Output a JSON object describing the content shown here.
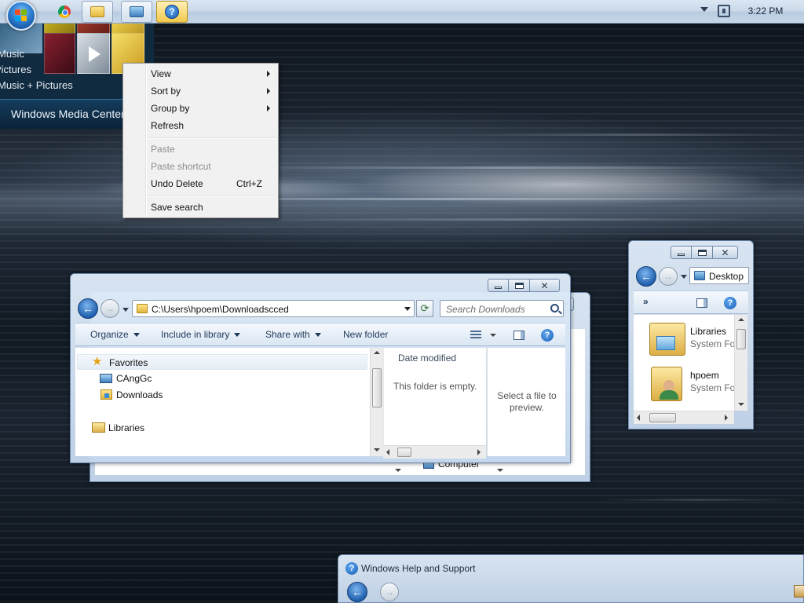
{
  "taskbar": {
    "clock": "3:22 PM",
    "buttons": [
      {
        "name": "google-chrome"
      },
      {
        "name": "windows-explorer"
      },
      {
        "name": "remote-desktop"
      },
      {
        "name": "windows-help-and-support"
      }
    ]
  },
  "media_center": {
    "menu_items": [
      "Music",
      "Pictures",
      "Music + Pictures"
    ],
    "title": "Windows Media Center"
  },
  "context_menu": {
    "items": [
      {
        "label": "View",
        "submenu": true,
        "enabled": true
      },
      {
        "label": "Sort by",
        "submenu": true,
        "enabled": true
      },
      {
        "label": "Group by",
        "submenu": true,
        "enabled": true
      },
      {
        "label": "Refresh",
        "submenu": false,
        "enabled": true
      },
      {
        "label": "Paste",
        "submenu": false,
        "enabled": false
      },
      {
        "label": "Paste shortcut",
        "submenu": false,
        "enabled": false
      },
      {
        "label": "Undo Delete",
        "shortcut": "Ctrl+Z",
        "submenu": false,
        "enabled": true
      },
      {
        "label": "Save search",
        "submenu": false,
        "enabled": true
      }
    ]
  },
  "explorer_main": {
    "address": "C:\\Users\\hpoem\\Downloadscced",
    "search_placeholder": "Search Downloads",
    "commands": {
      "organize": "Organize",
      "include_in_library": "Include in library",
      "share_with": "Share with",
      "new_folder": "New folder"
    },
    "nav_tree": {
      "favorites": "Favorites",
      "items": [
        "CAngGc",
        "Downloads"
      ],
      "libraries": "Libraries"
    },
    "column_header": "Date modified",
    "empty_message": "This folder is empty.",
    "preview_message": "Select a file to preview."
  },
  "explorer_back": {
    "nav_item": "Computer"
  },
  "explorer_desktop": {
    "address": "Desktop",
    "items": [
      {
        "name": "Libraries",
        "type": "System Fo"
      },
      {
        "name": "hpoem",
        "type": "System Fo"
      }
    ]
  },
  "help_window": {
    "title": "Windows Help and Support"
  },
  "colors": {
    "accent": "#1f5fae",
    "taskbar": "#c9d8e9",
    "menu_bg": "#f1f1f1",
    "disabled_text": "#8e8e8e"
  }
}
